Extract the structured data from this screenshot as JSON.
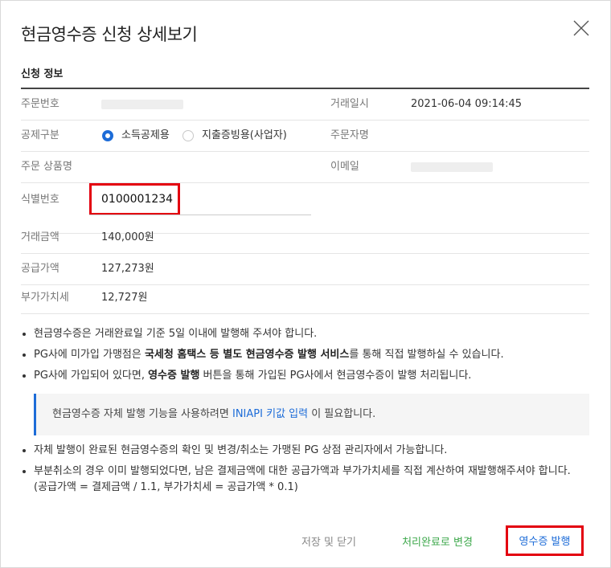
{
  "dialog": {
    "title": "현금영수증 신청 상세보기",
    "close_label": "닫기"
  },
  "section": {
    "title": "신청 정보"
  },
  "fields": {
    "order_no": {
      "label": "주문번호",
      "value": ""
    },
    "trade_date": {
      "label": "거래일시",
      "value": "2021-06-04 09:14:45"
    },
    "deduction_type": {
      "label": "공제구분",
      "option_income": "소득공제용",
      "option_expense": "지출증빙용(사업자)",
      "selected": "소득공제용"
    },
    "orderer_name": {
      "label": "주문자명",
      "value": ""
    },
    "product_name": {
      "label": "주문 상품명",
      "value": ""
    },
    "email": {
      "label": "이메일",
      "value": ""
    },
    "id_number": {
      "label": "식별번호",
      "value": "0100001234"
    },
    "trade_amount": {
      "label": "거래금액",
      "value": "140,000원"
    },
    "supply_amount": {
      "label": "공급가액",
      "value": "127,273원"
    },
    "vat": {
      "label": "부가가치세",
      "value": "12,727원"
    }
  },
  "notes": {
    "n1": "현금영수증은 거래완료일 기준 5일 이내에 발행해 주셔야 합니다.",
    "n2_a": "PG사에 미가입 가맹점은 ",
    "n2_b": "국세청 홈택스 등 별도 현금영수증 발행 서비스",
    "n2_c": "를 통해 직접 발행하실 수 있습니다.",
    "n3_a": "PG사에 가입되어 있다면, ",
    "n3_b": "영수증 발행",
    "n3_c": " 버튼을 통해 가입된 PG사에서 현금영수증이 발행 처리됩니다.",
    "info_a": "현금영수증 자체 발행 기능을 사용하려면 ",
    "info_link": "INIAPI 키값 입력",
    "info_c": " 이 필요합니다.",
    "n4": "자체 발행이 완료된 현금영수증의 확인 및 변경/취소는 가맹된 PG 상점 관리자에서 가능합니다.",
    "n5_line1": "부분취소의 경우 이미 발행되었다면, 남은 결제금액에 대한 공급가액과 부가가치세를 직접 계산하여 재발행해주셔야 합니다.",
    "n5_line2": "(공급가액 = 결제금액 / 1.1, 부가가치세 = 공급가액 * 0.1)"
  },
  "buttons": {
    "save_close": "저장 및 닫기",
    "mark_done": "처리완료로 변경",
    "issue_receipt": "영수증 발행"
  },
  "colors": {
    "accent": "#1d6cd8",
    "highlight_red": "#e30010",
    "done_green": "#3da84b"
  }
}
